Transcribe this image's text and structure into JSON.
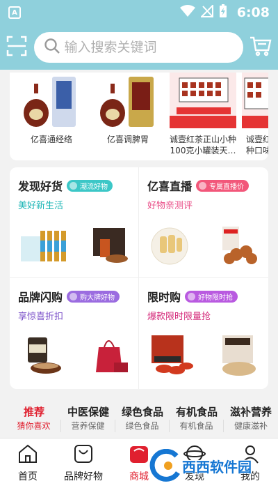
{
  "status_bar": {
    "app_badge": "A",
    "time": "6:08"
  },
  "search": {
    "placeholder": "输入搜索关键词"
  },
  "products": [
    {
      "name": "亿喜通经络",
      "line2": ""
    },
    {
      "name": "亿喜调脾胃",
      "line2": ""
    },
    {
      "name": "诚壹红茶正山小种",
      "line2": "100克小罐装天…"
    },
    {
      "name": "诚壹红",
      "line2": "种口味"
    }
  ],
  "promos": [
    {
      "title": "发现好货",
      "tag": "潮流好物",
      "subtitle": "美好新生活",
      "tag_color": "#3cc7c7",
      "sub_color": "#19b5b5"
    },
    {
      "title": "亿喜直播",
      "tag": "专属直播价",
      "subtitle": "好物亲测评",
      "tag_color": "#f2577a",
      "sub_color": "#e94b86"
    },
    {
      "title": "品牌闪购",
      "tag": "购大牌好物",
      "subtitle": "享惊喜折扣",
      "tag_color": "#9b6ce0",
      "sub_color": "#7a4fc8"
    },
    {
      "title": "限时购",
      "tag": "好物限时抢",
      "subtitle": "爆款限时限量抢",
      "tag_color": "#b95ae0",
      "sub_color": "#d42a7a"
    }
  ],
  "categories": [
    {
      "title": "推荐",
      "sub": "猜你喜欢",
      "active": true
    },
    {
      "title": "中医保健",
      "sub": "营养保健"
    },
    {
      "title": "绿色食品",
      "sub": "绿色食品"
    },
    {
      "title": "有机食品",
      "sub": "有机食品"
    },
    {
      "title": "滋补营养",
      "sub": "健康滋补"
    }
  ],
  "nav": [
    {
      "label": "首页",
      "icon": "home-icon"
    },
    {
      "label": "品牌好物",
      "icon": "bag-icon"
    },
    {
      "label": "商城",
      "icon": "shop-icon",
      "active": true
    },
    {
      "label": "发现",
      "icon": "discover-icon"
    },
    {
      "label": "我的",
      "icon": "user-icon"
    }
  ],
  "watermark": {
    "text": "西西软件园"
  },
  "colors": {
    "header": "#8fd0dc",
    "accent": "#e0202f"
  }
}
